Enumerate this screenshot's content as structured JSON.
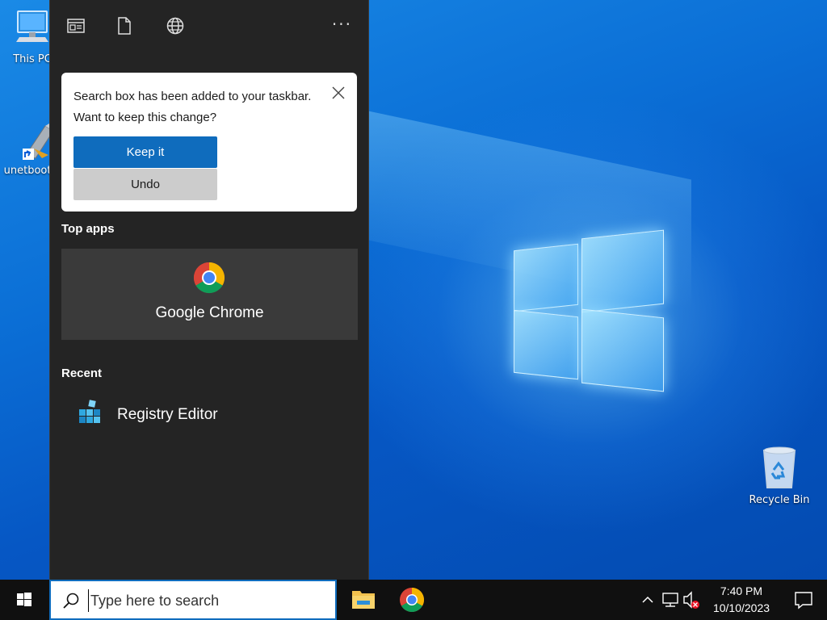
{
  "desktop": {
    "icons": [
      {
        "label": "This PC",
        "icon": "computer-icon"
      },
      {
        "label": "unetbootin",
        "icon": "unetbootin-shortcut-icon"
      },
      {
        "label": "Recycle Bin",
        "icon": "recycle-bin-icon"
      }
    ]
  },
  "flyout": {
    "toolbar": [
      {
        "icon": "apps-icon"
      },
      {
        "icon": "document-icon"
      },
      {
        "icon": "globe-icon"
      },
      {
        "icon": "more-options-icon",
        "text": "···"
      }
    ],
    "popup": {
      "message": "Search box has been added to your taskbar. Want to keep this change?",
      "keep_label": "Keep it",
      "undo_label": "Undo"
    },
    "top_apps_title": "Top apps",
    "top_apps": [
      {
        "label": "Google Chrome",
        "icon": "chrome-icon"
      }
    ],
    "recent_title": "Recent",
    "recent": [
      {
        "label": "Registry Editor",
        "icon": "registry-editor-icon"
      }
    ]
  },
  "taskbar": {
    "search_placeholder": "Type here to search",
    "pinned": [
      {
        "name": "File Explorer",
        "icon": "file-explorer-icon"
      },
      {
        "name": "Google Chrome",
        "icon": "chrome-icon"
      }
    ],
    "tray": {
      "chevron": "^",
      "time": "7:40 PM",
      "date": "10/10/2023"
    }
  },
  "colors": {
    "accent": "#0f6cbd",
    "flyout_bg": "#242424",
    "tile_bg": "#3a3a3a",
    "taskbar_bg": "#101010"
  }
}
